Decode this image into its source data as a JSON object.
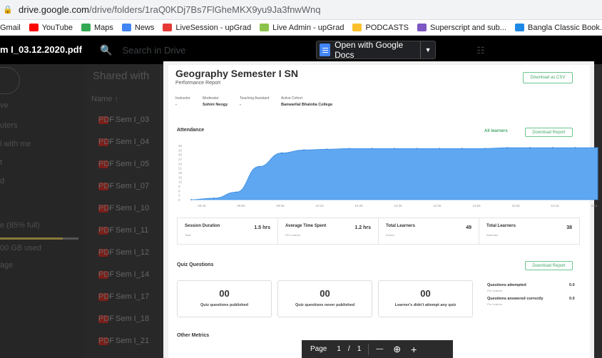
{
  "browser": {
    "url_host": "drive.google.com",
    "url_path": "/drive/folders/1raQ0KDj7Bs7FlGheMKX9yu9Ja3fnwWnq",
    "bookmarks": [
      {
        "label": "Gmail",
        "color": "#ea4335"
      },
      {
        "label": "YouTube",
        "color": "#ff0000"
      },
      {
        "label": "Maps",
        "color": "#34a853"
      },
      {
        "label": "News",
        "color": "#4285f4"
      },
      {
        "label": "LiveSession - upGrad",
        "color": "#e53935"
      },
      {
        "label": "Live Admin - upGrad",
        "color": "#8bc34a"
      },
      {
        "label": "PODCASTS",
        "color": "#fbc02d"
      },
      {
        "label": "Superscript and sub...",
        "color": "#7e57c2"
      },
      {
        "label": "Bangla Classic Book...",
        "color": "#1e88e5"
      }
    ]
  },
  "viewer": {
    "filename": "m I_03.12.2020.pdf",
    "search_placeholder": "Search in Drive",
    "open_with": "Open with Google Docs"
  },
  "drive": {
    "shared_title": "Shared with",
    "name_header": "Name",
    "sidebar": [
      "ve",
      "uters",
      "l with me",
      "t",
      "d",
      "e (85% full)",
      "00 GB used",
      "age"
    ],
    "files": [
      "Sem I_03",
      "Sem I_04",
      "Sem I_05",
      "Sem I_07",
      "Sem I_10",
      "Sem I_11",
      "Sem I_12",
      "Sem I_14",
      "Sem I_17",
      "Sem I_18",
      "Sem I_21"
    ]
  },
  "report": {
    "title": "Geography Semester I SN",
    "subtitle": "Performance Report",
    "download_csv": "Download as CSV",
    "meta": [
      {
        "label": "Instructor",
        "value": "-"
      },
      {
        "label": "Moderator",
        "value": "Sohini Neogy"
      },
      {
        "label": "Teaching Assistant",
        "value": "-"
      },
      {
        "label": "Active Cohort",
        "value": "Banwarilal Bhalotia College"
      }
    ],
    "attendance_title": "Attendance",
    "all_learners": "All learners",
    "download_report": "Download Report",
    "stats": [
      {
        "label": "Session Duration",
        "sub": "Total",
        "value": "1.5 hrs"
      },
      {
        "label": "Average Time Spent",
        "sub": "Per Learner",
        "value": "1.2 hrs"
      },
      {
        "label": "Total Learners",
        "sub": "Invited",
        "value": "49"
      },
      {
        "label": "Total Learners",
        "sub": "Attended",
        "value": "38"
      }
    ],
    "quiz_title": "Quiz Questions",
    "quiz_download": "Download Report",
    "quiz_boxes": [
      {
        "num": "00",
        "caption": "Quiz questions published"
      },
      {
        "num": "00",
        "caption": "Quiz questions never published"
      },
      {
        "num": "00",
        "caption": "Learner's didn't attempt any quiz"
      }
    ],
    "quiz_attempted_label": "Questions attempted",
    "quiz_attempted_sub": "Per Learner",
    "quiz_attempted_value": "0.0",
    "quiz_correct_label": "Questions answered correctly",
    "quiz_correct_sub": "Per Learner",
    "quiz_correct_value": "0.0",
    "other_metrics": "Other Metrics"
  },
  "chart_data": {
    "type": "area",
    "x": [
      "09:45",
      "09:50",
      "09:55",
      "10:00",
      "10:05",
      "10:10",
      "10:15",
      "10:20",
      "10:25",
      "10:30",
      "10:35",
      "10:40",
      "10:45",
      "10:50",
      "10:55",
      "11:00",
      "11:05",
      "11:10",
      "11:15"
    ],
    "x_tick_labels": [
      "09:45",
      "09:50",
      "09:55",
      "10:15",
      "10:25",
      "10:35",
      "10:45",
      "10:55",
      "10:05",
      "10:15",
      "10:1"
    ],
    "y_ticks": [
      "36",
      "33",
      "30",
      "27",
      "24",
      "21",
      "18",
      "15",
      "12",
      "9",
      "6",
      "3",
      "0"
    ],
    "values": [
      0,
      1,
      5,
      22,
      31,
      33,
      33.5,
      34,
      34,
      34,
      34,
      34,
      34,
      34,
      34.5,
      34.5,
      34.5,
      34.5,
      34.5
    ],
    "ylim": [
      0,
      36
    ],
    "color": "#5fa7f0"
  },
  "pagebar": {
    "page_label": "Page",
    "current": "1",
    "sep": "/",
    "total": "1",
    "zoom_out": "—",
    "zoom_in": "+"
  }
}
